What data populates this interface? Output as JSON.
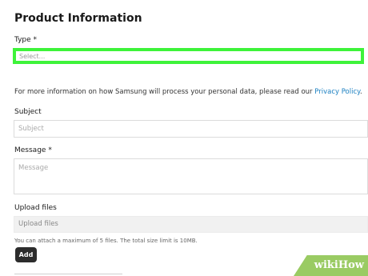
{
  "section_title": "Product Information",
  "type_field": {
    "label": "Type",
    "required_marker": "*",
    "placeholder": "Select..."
  },
  "privacy_notice": {
    "text": "For more information on how Samsung will process your personal data, please read our ",
    "link_text": "Privacy Policy",
    "end": "."
  },
  "subject_field": {
    "label": "Subject",
    "placeholder": "Subject"
  },
  "message_field": {
    "label": "Message",
    "required_marker": "*",
    "placeholder": "Message"
  },
  "upload_field": {
    "label": "Upload files",
    "placeholder": "Upload files",
    "note": "You can attach a maximum of 5 files. The total size limit is 10MB."
  },
  "add_button": {
    "label": "Add"
  },
  "watermark": {
    "text": "wikiHow"
  },
  "colors": {
    "highlight": "#3ef33a",
    "link": "#1a7fc1",
    "button": "#2c2c2c",
    "watermark": "#9acb63"
  }
}
